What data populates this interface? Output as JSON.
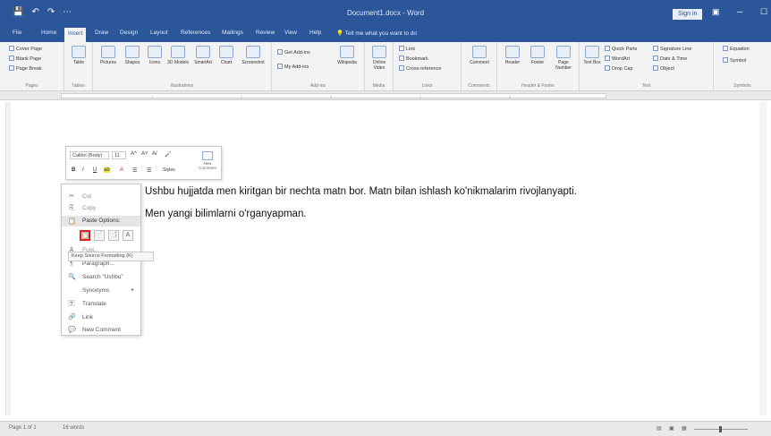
{
  "titlebar": {
    "doc_title": "Document1.docx - Word",
    "sign_in": "Sign in",
    "quick_access": [
      "💾",
      "↶",
      "↷",
      "⋯"
    ]
  },
  "tabs": [
    "File",
    "Home",
    "Insert",
    "Draw",
    "Design",
    "Layout",
    "References",
    "Mailings",
    "Review",
    "View",
    "Help"
  ],
  "active_tab": "Insert",
  "tell_me": "Tell me what you want to do",
  "ribbon": {
    "pages": {
      "label": "Pages",
      "items": [
        "Cover Page",
        "Blank Page",
        "Page Break"
      ]
    },
    "tables": {
      "label": "Tables",
      "button": "Table"
    },
    "illustrations": {
      "label": "Illustrations",
      "buttons": [
        "Pictures",
        "Shapes",
        "Icons",
        "3D Models",
        "SmartArt",
        "Chart",
        "Screenshot"
      ]
    },
    "addins": {
      "label": "Add-ins",
      "items": [
        "Get Add-ins",
        "My Add-ins",
        "Wikipedia"
      ]
    },
    "media": {
      "label": "Media",
      "button": "Online Video"
    },
    "links": {
      "label": "Links",
      "items": [
        "Link",
        "Bookmark",
        "Cross-reference"
      ]
    },
    "comments": {
      "label": "Comments",
      "button": "Comment"
    },
    "header_footer": {
      "label": "Header & Footer",
      "buttons": [
        "Header",
        "Footer",
        "Page Number"
      ]
    },
    "text": {
      "label": "Text",
      "button": "Text Box",
      "items": [
        "Quick Parts",
        "WordArt",
        "Drop Cap",
        "Signature Line",
        "Date & Time",
        "Object"
      ]
    },
    "symbols": {
      "label": "Symbols",
      "items": [
        "Equation",
        "Symbol"
      ]
    }
  },
  "document": {
    "line1": "Ushbu hujjatda men kiritgan bir nechta matn bor. Matn bilan ishlash ko'nikmalarim rivojlanyapti.",
    "line2": "Men yangi bilimlarni o'rganyapman."
  },
  "mini_toolbar": {
    "font": "Calibri (Body)",
    "size": "11",
    "row1_icons": [
      "A^",
      "A˅",
      "A/",
      "🖌"
    ],
    "row2_icons": [
      "B",
      "I",
      "U",
      "ab",
      "A",
      "☰",
      "☰",
      "Styles"
    ],
    "new_comment": "New Comment"
  },
  "context_menu": {
    "items": [
      {
        "icon": "✂",
        "label": "Cut",
        "enabled": false
      },
      {
        "icon": "⎘",
        "label": "Copy",
        "enabled": false
      }
    ],
    "paste_header": "Paste Options:",
    "paste_options": [
      "📋",
      "📄",
      "📑",
      "A"
    ],
    "tooltip": "Keep Source Formatting (K)",
    "lower_items": [
      {
        "icon": "A",
        "label": "Font...",
        "enabled": false
      },
      {
        "icon": "¶",
        "label": "Paragraph...",
        "enabled": true
      },
      {
        "icon": "🔍",
        "label": "Search \"Ushbu\"",
        "enabled": true
      },
      {
        "icon": "",
        "label": "Synonyms",
        "enabled": true,
        "submenu": true
      },
      {
        "icon": "🈂",
        "label": "Translate",
        "enabled": true
      },
      {
        "icon": "🔗",
        "label": "Link",
        "enabled": true
      },
      {
        "icon": "💬",
        "label": "New Comment",
        "enabled": true
      }
    ]
  },
  "status": {
    "page": "Page 1 of 1",
    "words": "16 words"
  }
}
